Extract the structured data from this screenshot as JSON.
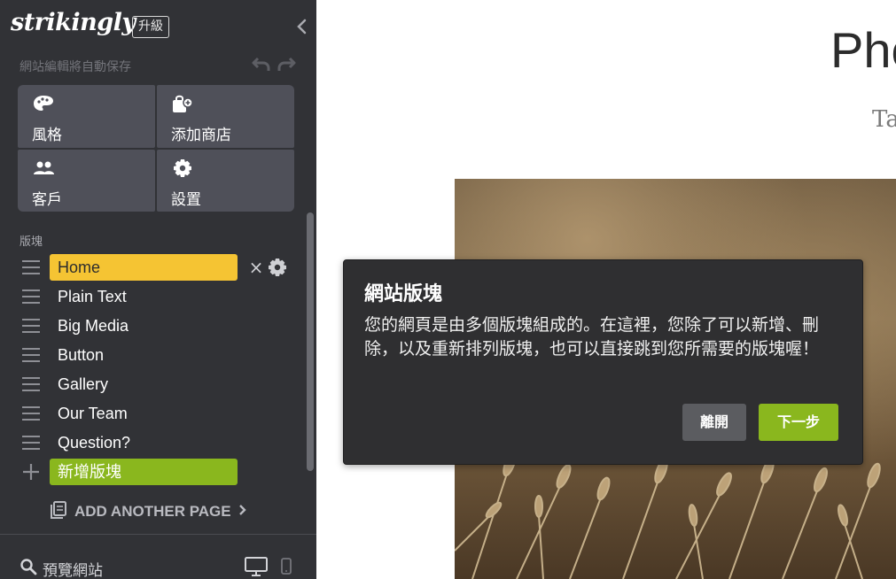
{
  "app": {
    "logo": "strikingly",
    "upgrade_label": "升級",
    "autosave_text": "網站編輯將自動保存"
  },
  "tiles": [
    {
      "label": "風格",
      "icon": "palette-icon"
    },
    {
      "label": "添加商店",
      "icon": "shopping-bag-icon"
    },
    {
      "label": "客戶",
      "icon": "users-icon"
    },
    {
      "label": "設置",
      "icon": "gear-icon"
    }
  ],
  "sections": {
    "label": "版塊",
    "items": [
      "Home",
      "Plain Text",
      "Big Media",
      "Button",
      "Gallery",
      "Our Team",
      "Question?"
    ],
    "active_index": 0,
    "add_label": "新增版塊"
  },
  "footer": {
    "add_page_label": "ADD ANOTHER PAGE",
    "preview_label": "預覽網站"
  },
  "page": {
    "hero_title": "Pho",
    "hero_subtitle": "Ta"
  },
  "popover": {
    "title": "網站版塊",
    "body": "您的網頁是由多個版塊組成的。在這裡，您除了可以新增、刪除，以及重新排列版塊，也可以直接跳到您所需要的版塊喔！",
    "leave_label": "離開",
    "next_label": "下一步"
  },
  "colors": {
    "sidebar_bg": "#313236",
    "tile_bg": "#4f5059",
    "active_section": "#f5c433",
    "add_section": "#8ab71e",
    "next_button": "#8ab71e",
    "leave_button": "#5b5c60",
    "popover_bg": "#2f2f31"
  }
}
